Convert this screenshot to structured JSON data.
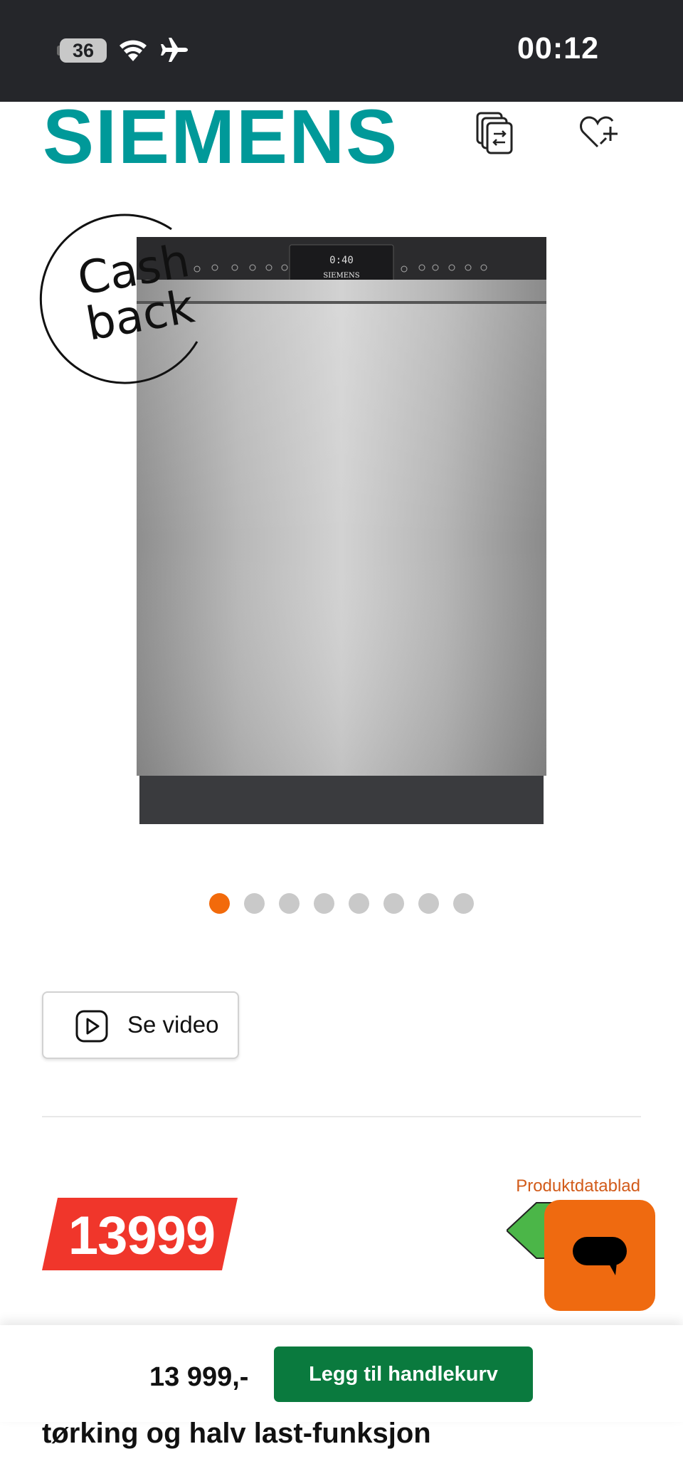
{
  "status_bar": {
    "battery": "36",
    "time": "00:12"
  },
  "header": {
    "brand": "SIEMENS",
    "compare_icon": "compare-icon",
    "wishlist_icon": "heart-plus-icon"
  },
  "product": {
    "badge_line1": "Cash",
    "badge_line2": "back",
    "image_dots_count": 8,
    "active_dot": 1
  },
  "video_button": {
    "label": "Se video",
    "icon": "play-icon"
  },
  "price_section": {
    "price": "13999",
    "datasheet_link": "Produktdatablad"
  },
  "sticky_bar": {
    "price": "13 999,-",
    "cart_button": "Legg til handlekurv"
  },
  "title_peek": "tørking og halv last-funksjon",
  "colors": {
    "brand": "#009999",
    "accent": "#f26a0b",
    "price": "#f0362b",
    "cart": "#0a7a3e"
  }
}
